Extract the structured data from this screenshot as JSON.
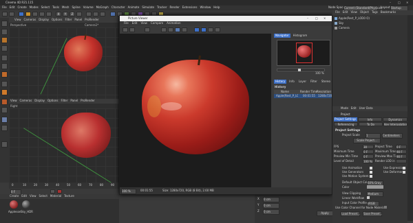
{
  "app": {
    "title": "Cinema 4D R21.115",
    "layout_label": "Node Space:",
    "layout_value": "Current (Standard/Physical)",
    "layout2_label": "Layout:",
    "layout2_value": "Startup"
  },
  "main_menu": [
    "File",
    "Edit",
    "Create",
    "Modes",
    "Select",
    "Tools",
    "Mesh",
    "Spline",
    "Volume",
    "MoGraph",
    "Character",
    "Animate",
    "Simulate",
    "Tracker",
    "Render",
    "Extensions",
    "Window",
    "Help"
  ],
  "om_menu": [
    "File",
    "Edit",
    "View",
    "Object",
    "Tags",
    "Bookmarks"
  ],
  "objects": [
    {
      "name": "Apple(Rest_P_LOD0 O)"
    },
    {
      "name": "Sky"
    },
    {
      "name": "Camera"
    }
  ],
  "vp_top": {
    "menu": [
      "View",
      "Cameras",
      "Display",
      "Options",
      "Filter",
      "Panel",
      "ProRender"
    ],
    "label": "Perspective",
    "cam": "Camera1*"
  },
  "vp_bottom": {
    "menu": [
      "View",
      "Cameras",
      "Display",
      "Options",
      "Filter",
      "Panel",
      "ProRender"
    ],
    "label": "Right"
  },
  "picture_viewer": {
    "title": "Picture Viewer",
    "menu": [
      "File",
      "Edit",
      "View",
      "Compare",
      "Animation"
    ],
    "zoom": "100 %",
    "time": "00:01:55",
    "status": "Size: 1280x720, RGB (8 Bit), 2.60 MB"
  },
  "navigator": {
    "tabs": [
      "Navigator",
      "Histogram"
    ],
    "zoom": "100 %"
  },
  "history": {
    "tabs": [
      "History",
      "Info",
      "Layer",
      "Filter",
      "Stereo"
    ],
    "title": "History",
    "col_name": "Name",
    "col_time": "Render Time",
    "col_res": "Resolution",
    "row_name": "Apple(Rest_P_LOD0 O)",
    "row_time": "00:01:55",
    "row_res": "1280x720"
  },
  "attributes": {
    "menu": [
      "Mode",
      "Edit",
      "User Data"
    ],
    "title": "Project",
    "tabs": [
      "Project Settings",
      "Info",
      "Dynamics"
    ],
    "tabs2": [
      "Referencing",
      "To Do",
      "Key Interpolation"
    ],
    "section": "Project Settings",
    "scale_label": "Project Scale",
    "scale_value": "1",
    "scale_unit": "Centimeters",
    "scale_btn": "Scale Project...",
    "fields_left": [
      {
        "label": "FPS",
        "value": "30"
      },
      {
        "label": "Minimum Time",
        "value": "0 F"
      },
      {
        "label": "Preview Min Time",
        "value": "0 F"
      },
      {
        "label": "Level of Detail",
        "value": "100 %"
      }
    ],
    "fields_right": [
      {
        "label": "Project Time",
        "value": "0 F"
      },
      {
        "label": "Maximum Time",
        "value": "90 F"
      },
      {
        "label": "Preview Max Time",
        "value": "90 F"
      },
      {
        "label": "Render LOD in Editor",
        "value": ""
      }
    ],
    "checks_left": [
      "Use Animation",
      "Use Generators",
      "Use Motion System"
    ],
    "checks_right": [
      "Use Expressions",
      "Use Deformers"
    ],
    "default_color_label": "Default Object Color",
    "default_color_value": "60% Gray",
    "color_label": "Color",
    "view_clip_label": "View Clipping",
    "view_clip_value": "Medium",
    "linear_label": "Linear Workflow",
    "input_profile_label": "Input Color Profile",
    "input_profile_value": "sRGB",
    "color_chan_label": "Use Color Channel for Node Material",
    "load_btn": "Load Preset...",
    "save_btn": "Save Preset..."
  },
  "timeline": {
    "ticks": [
      "0",
      "10",
      "20",
      "30",
      "40",
      "50",
      "60",
      "70",
      "80",
      "90"
    ],
    "frame_left": "0 F",
    "frame_right": "90 F"
  },
  "materials": {
    "menu": [
      "Create",
      "Edit",
      "View",
      "Select",
      "Material",
      "Texture"
    ],
    "items": [
      {
        "name": "Appleson"
      },
      {
        "name": "Sky_HDR"
      }
    ]
  },
  "coords": {
    "labels": [
      "X",
      "Y",
      "Z"
    ],
    "values": [
      "0 cm",
      "0 cm",
      "0 cm"
    ],
    "apply": "Apply"
  }
}
